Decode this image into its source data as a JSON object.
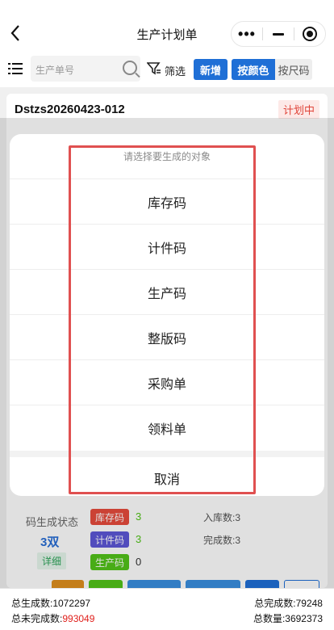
{
  "header": {
    "title": "生产计划单",
    "back_icon": "‹",
    "more_icon": "•••"
  },
  "search": {
    "placeholder": "生产单号",
    "filter_label": "筛选",
    "new_label": "新增",
    "segment_active": "按颜色",
    "segment_inactive": "按尺码"
  },
  "card": {
    "order_no": "Dstzs20260423-012",
    "status": "计划中",
    "gen_status_label": "码生成状态",
    "gen_count": "3双",
    "detail_label": "详细",
    "tags": [
      {
        "label": "库存码",
        "value": "3",
        "color": "#e84c3d"
      },
      {
        "label": "计件码",
        "value": "3",
        "color": "#5d57d8"
      },
      {
        "label": "生产码",
        "value": "0",
        "color": "#52c41a"
      }
    ],
    "stats": [
      {
        "label": "入库数:3"
      },
      {
        "label": "完成数:3"
      }
    ]
  },
  "modal": {
    "title": "请选择要生成的对象",
    "options": [
      "库存码",
      "计件码",
      "生产码",
      "整版码",
      "采购单",
      "领料单"
    ],
    "cancel": "取消"
  },
  "footer": {
    "total_generated": "总生成数:1072297",
    "total_completed": "总完成数:79248",
    "uncompleted_label": "总未完成数:",
    "uncompleted_value": "993049",
    "total_quantity": "总数量:3692373"
  },
  "colors": {
    "primary": "#1f6fd6",
    "danger": "#e0201c",
    "highlight_border": "#e05050"
  }
}
